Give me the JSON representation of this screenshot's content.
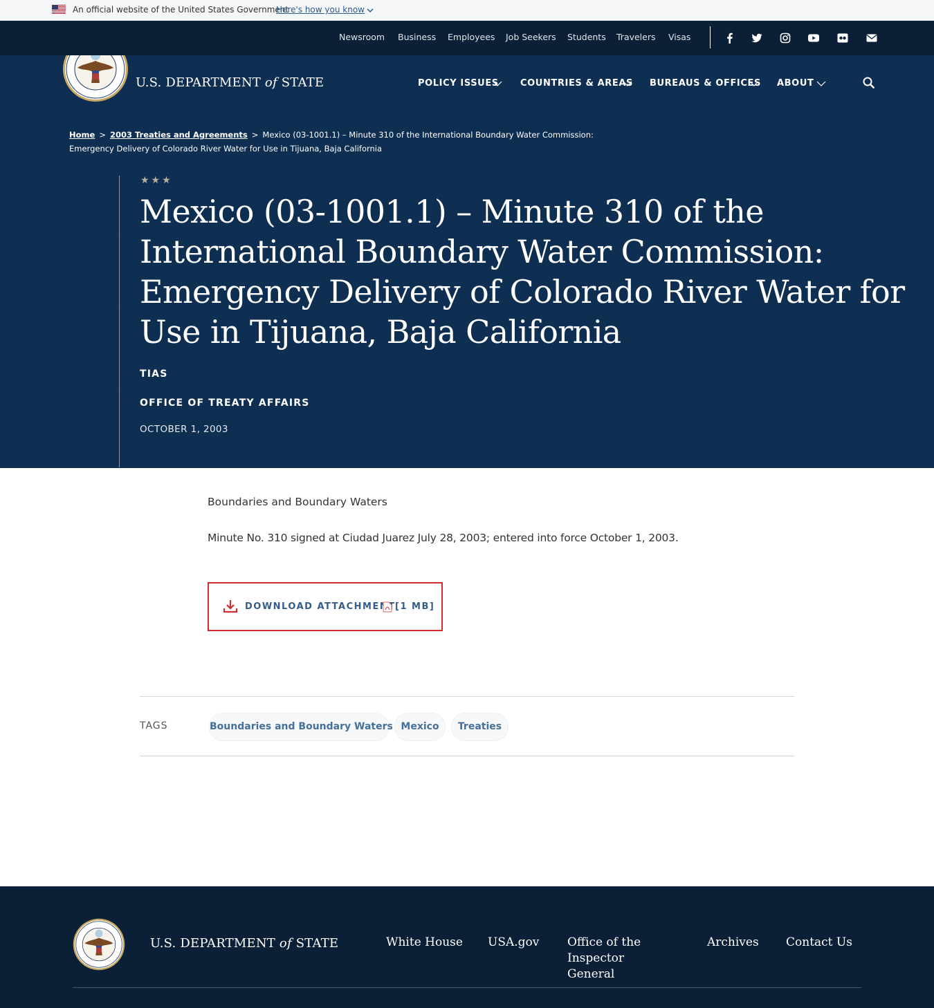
{
  "gov_banner": {
    "text": "An official website of the United States Government",
    "link": "Here's how you know"
  },
  "utility_nav": {
    "links": [
      "Newsroom",
      "Business",
      "Employees",
      "Job Seekers",
      "Students",
      "Travelers",
      "Visas"
    ],
    "social_icons": [
      "facebook-icon",
      "twitter-icon",
      "instagram-icon",
      "youtube-icon",
      "flickr-icon",
      "email-icon"
    ]
  },
  "header": {
    "brand_prefix": "U.S. DEPARTMENT",
    "brand_of": "of",
    "brand_suffix": "STATE",
    "nav": [
      "POLICY ISSUES",
      "COUNTRIES & AREAS",
      "BUREAUS & OFFICES",
      "ABOUT"
    ]
  },
  "breadcrumb": {
    "home": "Home",
    "section": "2003 Treaties and Agreements",
    "separator": ">",
    "current": "Mexico (03-1001.1) – Minute 310 of the International Boundary Water Commission: Emergency Delivery of Colorado River Water for Use in Tijuana, Baja California"
  },
  "article": {
    "stars": "★★★",
    "title": "Mexico (03-1001.1) – Minute 310 of the International Boundary Water Commission: Emergency Delivery of Colorado River Water for Use in Tijuana, Baja California",
    "author_short": "TIAS",
    "office": "OFFICE OF TREATY AFFAIRS",
    "date": "OCTOBER 1, 2003",
    "paragraph_1": "Boundaries and Boundary Waters",
    "paragraph_2": "Minute No. 310 signed at Ciudad Juarez July 28, 2003; entered into force October 1, 2003.",
    "download_label": "DOWNLOAD ATTACHMENT",
    "download_size": "[1 MB]"
  },
  "tags": {
    "label": "TAGS",
    "items": [
      "Boundaries and Boundary Waters",
      "Mexico",
      "Treaties"
    ]
  },
  "footer": {
    "brand_prefix": "U.S. DEPARTMENT",
    "brand_of": "of",
    "brand_suffix": "STATE",
    "links": [
      "White House",
      "USA.gov",
      "Office of the Inspector General",
      "Archives",
      "Contact Us"
    ]
  },
  "colors": {
    "hero_blue": "#0f2f52",
    "dark_navy": "#0b2037",
    "accent_red": "#d02c2f",
    "link_blue": "#355d8a"
  }
}
